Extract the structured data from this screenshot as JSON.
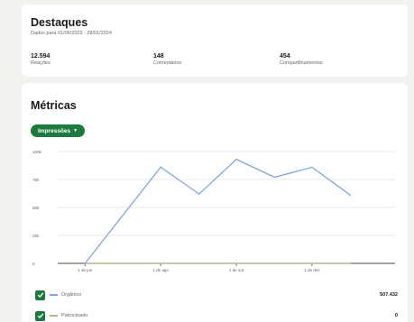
{
  "highlights": {
    "title": "Destaques",
    "subtitle": "Dados para 01/06/2023 - 28/01/2024",
    "stats": [
      {
        "value": "12.594",
        "label": "Reações"
      },
      {
        "value": "148",
        "label": "Comentários"
      },
      {
        "value": "454",
        "label": "Compartilhamentos"
      }
    ]
  },
  "metrics": {
    "title": "Métricas",
    "dropdown_label": "Impressões",
    "icons": {
      "dropdown": "chevron-down-icon",
      "checkbox": "checkmark-icon"
    }
  },
  "colors": {
    "brand_green": "#1d7a3f",
    "organic_line": "#7da6e0",
    "sponsored_line": "#b5b58a",
    "axis": "#444444",
    "grid": "#e2e2e2"
  },
  "chart_data": {
    "type": "line",
    "x": [
      "2023-06-01",
      "2023-08-01",
      "2023-09-01",
      "2023-10-01",
      "2023-11-01",
      "2023-12-01",
      "2024-01-01"
    ],
    "xticks": [
      "1 de jun",
      "1 de ago",
      "1 de out",
      "1 de dez"
    ],
    "ytick_labels": [
      "0",
      "25k",
      "50k",
      "75k",
      "100k"
    ],
    "yticks": [
      0,
      25000,
      50000,
      75000,
      100000
    ],
    "ylim": [
      0,
      100000
    ],
    "grid": true,
    "series": [
      {
        "name": "Orgânico",
        "values": [
          0,
          86000,
          62000,
          93000,
          77000,
          86000,
          61000
        ],
        "total": "507.432"
      },
      {
        "name": "Patrocinado",
        "values": [
          0,
          0,
          0,
          0,
          0,
          0,
          0
        ],
        "total": "0"
      }
    ]
  }
}
